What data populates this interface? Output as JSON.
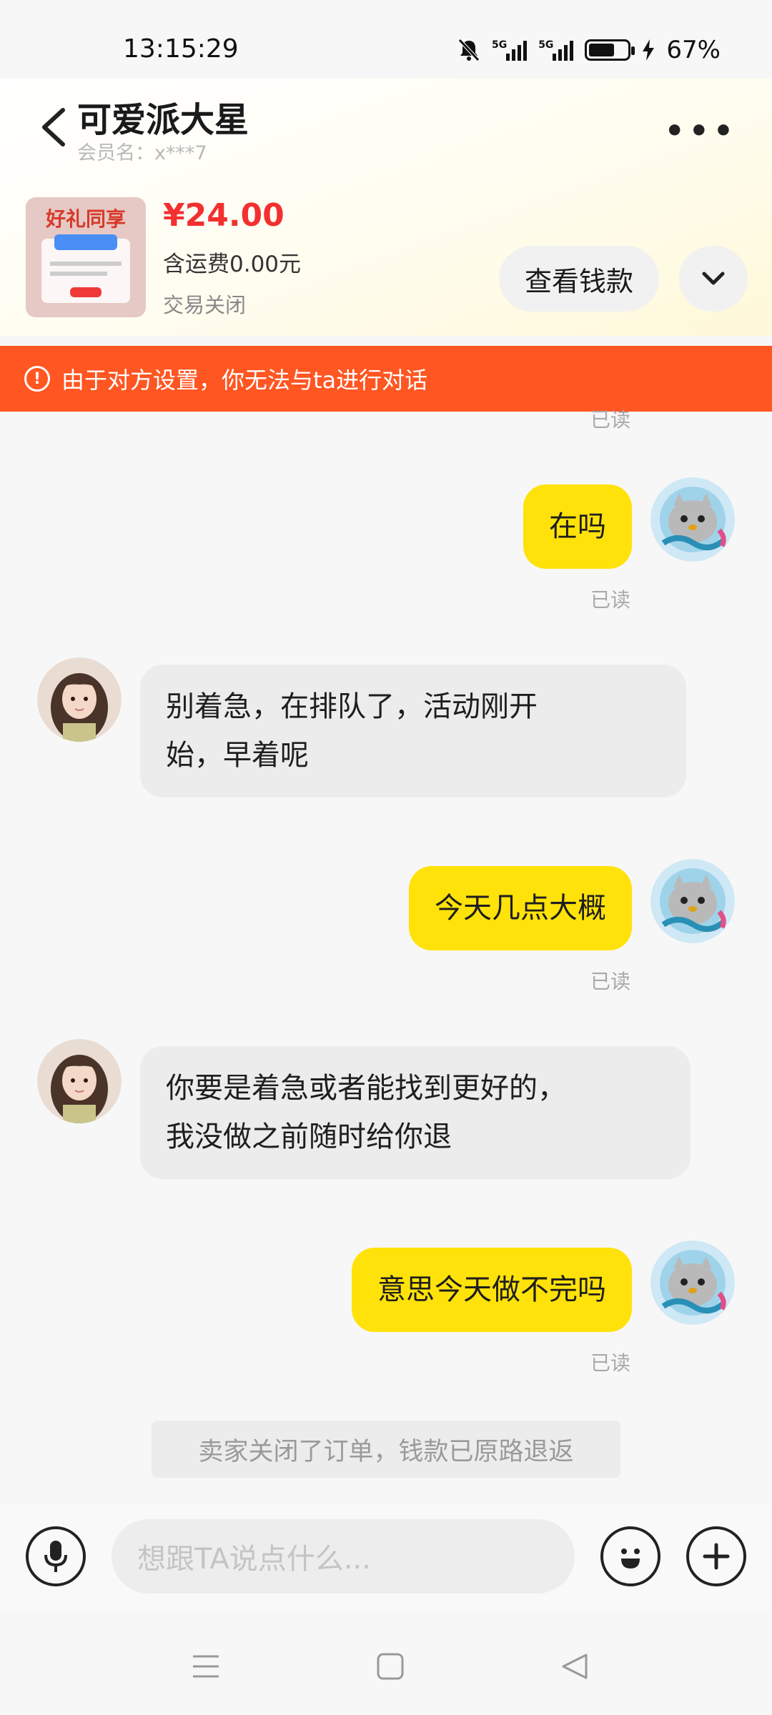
{
  "status_bar": {
    "time": "13:15:29",
    "network1": "5G",
    "network2": "5G",
    "battery": "67%",
    "battery_level": 0.67
  },
  "header": {
    "title": "可爱派大星",
    "member": "会员名：x***7",
    "more_icon": "more-dots-icon"
  },
  "order": {
    "price": "¥24.00",
    "shipping": "含运费0.00元",
    "status": "交易关闭",
    "view_button": "查看钱款"
  },
  "warning": {
    "text": "由于对方设置，你无法与ta进行对话",
    "icon": "!"
  },
  "messages": [
    {
      "from": "me",
      "text": "在吗",
      "read": "已读"
    },
    {
      "from": "other",
      "line1": "别着急，在排队了，活动刚开",
      "line2": "始，早着呢"
    },
    {
      "from": "me",
      "text": "今天几点大概",
      "read": "已读"
    },
    {
      "from": "other",
      "line1": "你要是着急或者能找到更好的，",
      "line2": "我没做之前随时给你退"
    },
    {
      "from": "me",
      "text": "意思今天做不完吗",
      "read": "已读"
    }
  ],
  "top_read": "已读",
  "system_message": "卖家关闭了订单，钱款已原路退返",
  "input": {
    "placeholder": "想跟TA说点什么..."
  },
  "colors": {
    "accent": "#ffe209",
    "warning": "#ff5622",
    "price": "#f23030"
  }
}
